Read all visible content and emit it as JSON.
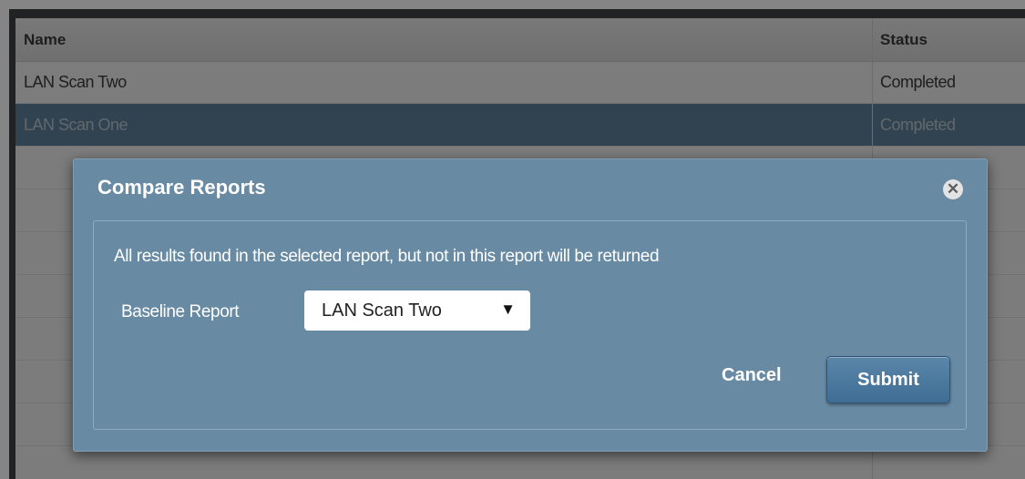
{
  "table": {
    "columns": {
      "name": "Name",
      "status": "Status"
    },
    "rows": [
      {
        "name": "LAN Scan Two",
        "status": "Completed",
        "selected": false
      },
      {
        "name": "LAN Scan One",
        "status": "Completed",
        "selected": true
      }
    ]
  },
  "dialog": {
    "title": "Compare Reports",
    "close_icon": "close-icon",
    "message": "All results found in the selected report, but not in this report will be returned",
    "baseline_label": "Baseline Report",
    "baseline_selected": "LAN Scan Two",
    "cancel_label": "Cancel",
    "submit_label": "Submit"
  },
  "colors": {
    "dialog_bg": "#688aa3",
    "selected_row": "#5f7f99",
    "submit_button": "#4b789e"
  }
}
